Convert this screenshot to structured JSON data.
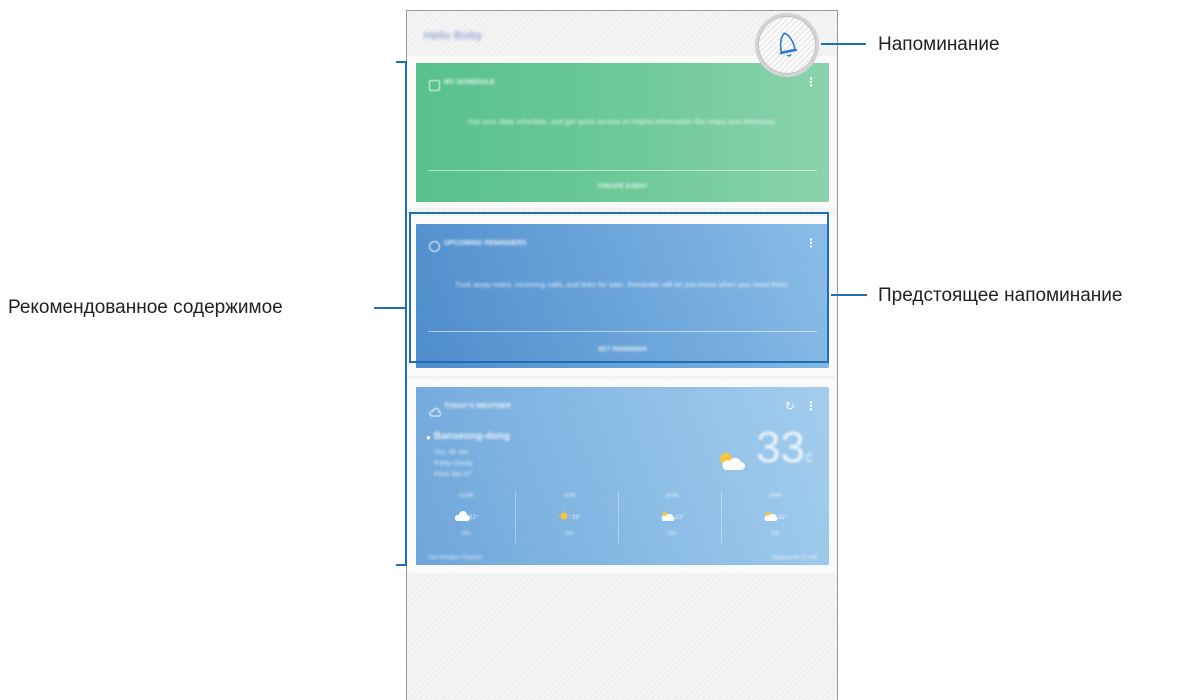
{
  "annotations": {
    "reminder": "Напоминание",
    "upcoming_reminder": "Предстоящее напоминание",
    "recommended_content": "Рекомендованное содержимое"
  },
  "screen": {
    "header": "Hello Bixby",
    "cards": [
      {
        "type": "schedule",
        "icon": "calendar-icon",
        "title": "MY SCHEDULE",
        "body": "Get your daily schedule, and get quick access to helpful information like maps and directions.",
        "action": "CREATE EVENT",
        "color": "#6fc99b"
      },
      {
        "type": "reminder",
        "icon": "bell-icon",
        "title": "UPCOMING REMINDERS",
        "body": "Tuck away notes, incoming calls, and links for later. Reminder will let you know when you need them.",
        "action": "SET REMINDER",
        "color": "#6aa4d9"
      },
      {
        "type": "weather",
        "icon": "cloud-icon",
        "title": "TODAY'S WEATHER",
        "location": "Banseong-dong",
        "lines": [
          "Thu, 05 Jan",
          "Partly Cloudy",
          "Feels like 37°"
        ],
        "temperature": "33",
        "unit": "c",
        "hours": [
          {
            "time": "11AM",
            "icon": "cloud-icon",
            "temp": "32°",
            "rain": "0%"
          },
          {
            "time": "1PM",
            "icon": "sun-icon",
            "temp": "35°",
            "rain": "0%"
          },
          {
            "time": "3PM",
            "icon": "moon-cloud-icon",
            "temp": "33°",
            "rain": "0%"
          },
          {
            "time": "5PM",
            "icon": "moon-cloud-icon",
            "temp": "31°",
            "rain": "0%"
          }
        ],
        "footer_left": "The Weather Channel",
        "footer_right": "Updated 04:15 PM",
        "color": "#8cbde6"
      }
    ]
  }
}
